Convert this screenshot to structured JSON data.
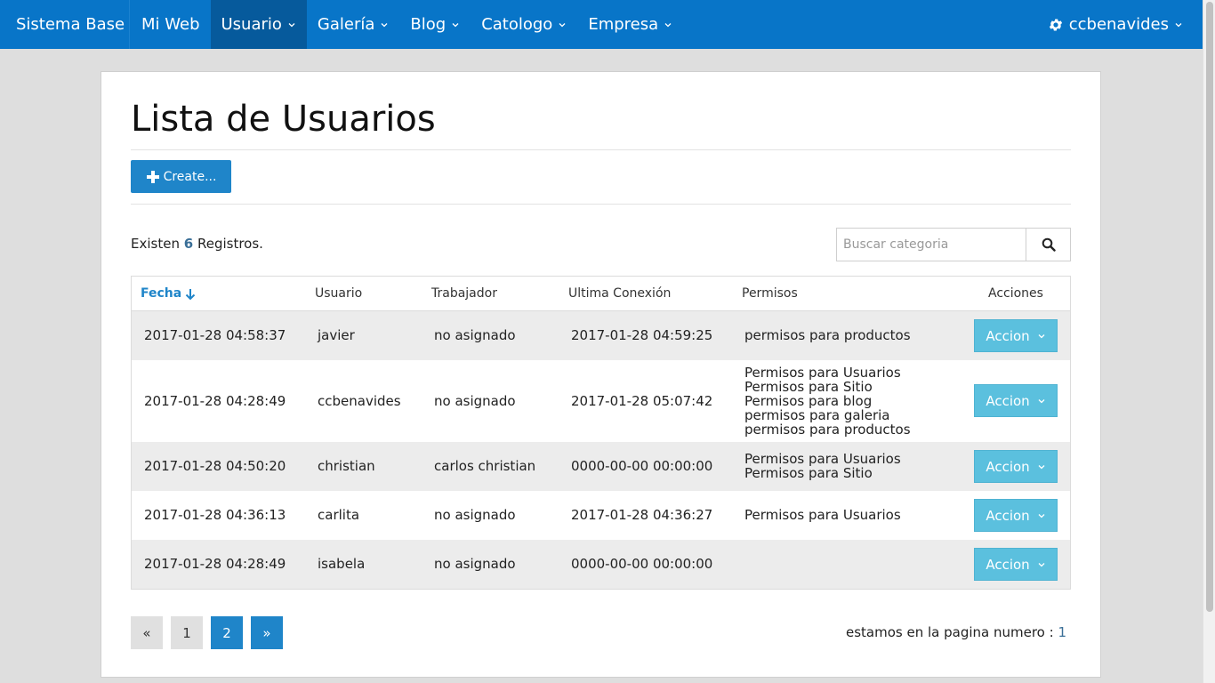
{
  "navbar": {
    "brand": "Sistema Base",
    "items": [
      {
        "label": "Mi Web",
        "dropdown": false,
        "active": false
      },
      {
        "label": "Usuario",
        "dropdown": true,
        "active": true
      },
      {
        "label": "Galería",
        "dropdown": true,
        "active": false
      },
      {
        "label": "Blog",
        "dropdown": true,
        "active": false
      },
      {
        "label": "Catologo",
        "dropdown": true,
        "active": false
      },
      {
        "label": "Empresa",
        "dropdown": true,
        "active": false
      }
    ],
    "user": {
      "name": "ccbenavides",
      "icon": "gear-icon"
    }
  },
  "page": {
    "title": "Lista de Usuarios",
    "create_label": "Create...",
    "records_prefix": "Existen",
    "records_count": "6",
    "records_suffix": "Registros."
  },
  "search": {
    "placeholder": "Buscar categoria",
    "value": ""
  },
  "table": {
    "headers": {
      "fecha": "Fecha",
      "usuario": "Usuario",
      "trabajador": "Trabajador",
      "ultima": "Ultima Conexión",
      "permisos": "Permisos",
      "acciones": "Acciones"
    },
    "sort_column": "Fecha",
    "sort_direction": "descending",
    "rows": [
      {
        "fecha": "2017-01-28 04:58:37",
        "usuario": "javier",
        "trabajador": "no asignado",
        "ultima": "2017-01-28 04:59:25",
        "permisos": [
          "permisos para productos"
        ],
        "accion": "Accion"
      },
      {
        "fecha": "2017-01-28 04:28:49",
        "usuario": "ccbenavides",
        "trabajador": "no asignado",
        "ultima": "2017-01-28 05:07:42",
        "permisos": [
          "Permisos para Usuarios",
          "Permisos para Sitio",
          "Permisos para blog",
          "permisos para galeria",
          "permisos para productos"
        ],
        "accion": "Accion"
      },
      {
        "fecha": "2017-01-28 04:50:20",
        "usuario": "christian",
        "trabajador": "carlos christian",
        "ultima": "0000-00-00 00:00:00",
        "permisos": [
          "Permisos para Usuarios",
          "Permisos para Sitio"
        ],
        "accion": "Accion"
      },
      {
        "fecha": "2017-01-28 04:36:13",
        "usuario": "carlita",
        "trabajador": "no asignado",
        "ultima": "2017-01-28 04:36:27",
        "permisos": [
          "Permisos para Usuarios"
        ],
        "accion": "Accion"
      },
      {
        "fecha": "2017-01-28 04:28:49",
        "usuario": "isabela",
        "trabajador": "no asignado",
        "ultima": "0000-00-00 00:00:00",
        "permisos": [],
        "accion": "Accion"
      }
    ]
  },
  "pagination": {
    "prev": "«",
    "pages": [
      "1",
      "2"
    ],
    "current_highlight": "2",
    "next": "»",
    "status_prefix": "estamos en la pagina numero :",
    "status_number": "1"
  },
  "colors": {
    "navbar": "#0875c8",
    "navbar_active": "#065a9c",
    "primary": "#1f85c9",
    "accion": "#5bc0de",
    "row_stripe": "#ececec"
  }
}
